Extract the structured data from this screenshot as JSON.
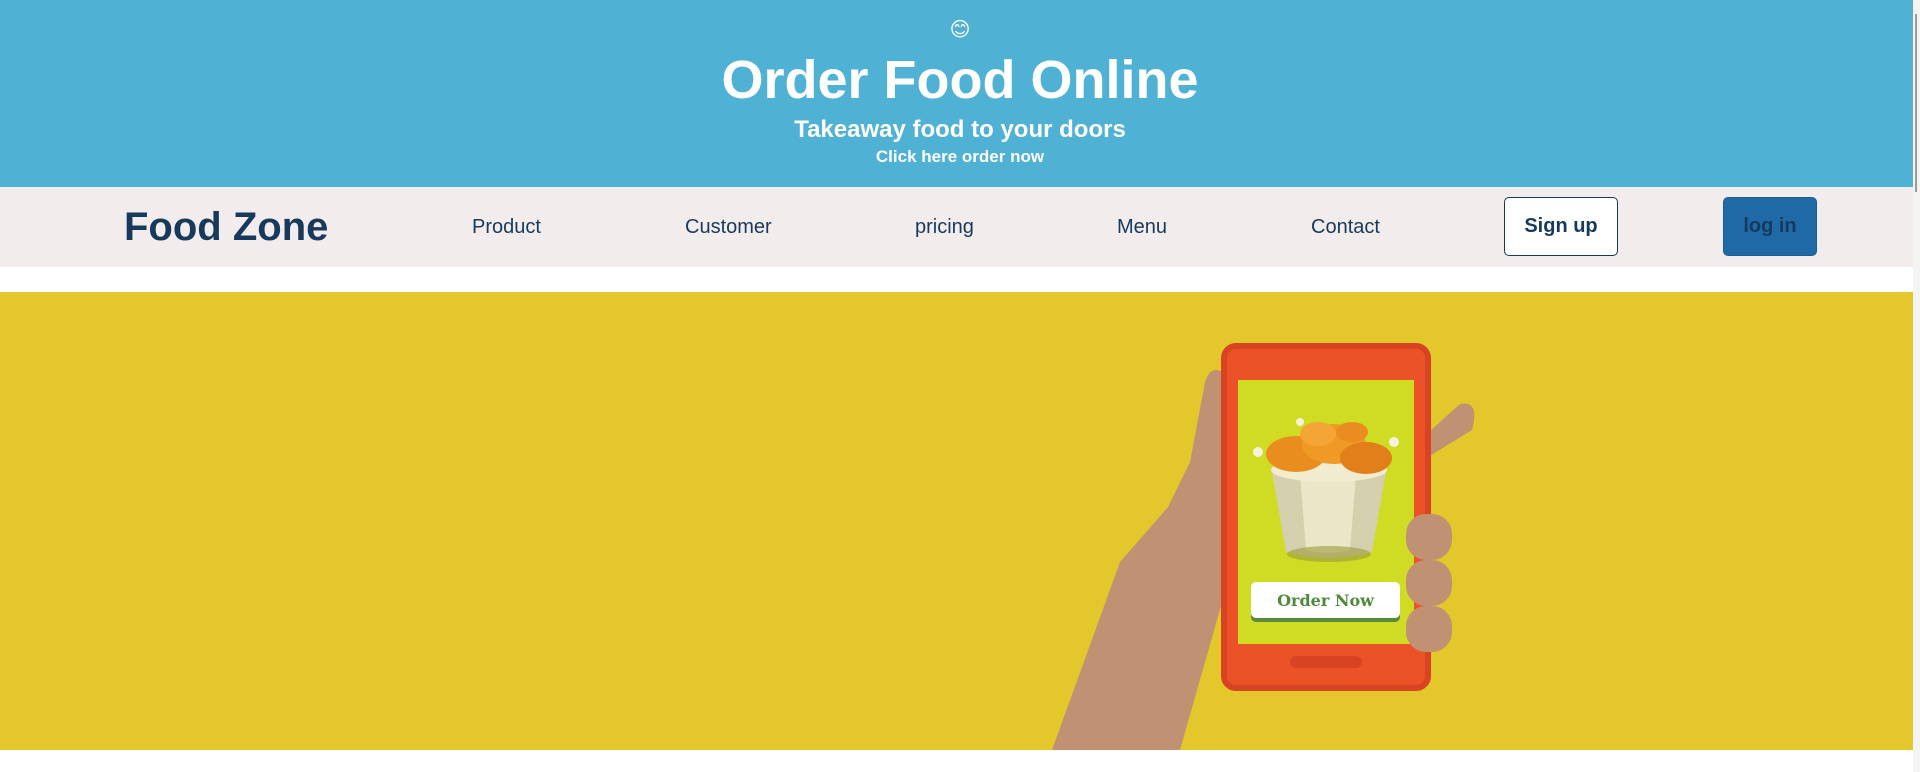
{
  "banner": {
    "emoji": "😊",
    "title": "Order Food Online",
    "subtitle": "Takeaway food to your doors",
    "cta_link": "Click here order now",
    "color": "#4fb1d4"
  },
  "navbar": {
    "brand": "Food Zone",
    "links": [
      "Product",
      "Customer",
      "pricing",
      "Menu",
      "Contact"
    ],
    "signup_label": "Sign up",
    "login_label": "log in",
    "background": "#f2ecec",
    "text_color": "#173a5c"
  },
  "hero": {
    "background": "#e4c82b",
    "order_button_label": "Order Now",
    "icons": [
      "hand-holding-phone-icon",
      "fried-chicken-bucket-icon"
    ]
  }
}
